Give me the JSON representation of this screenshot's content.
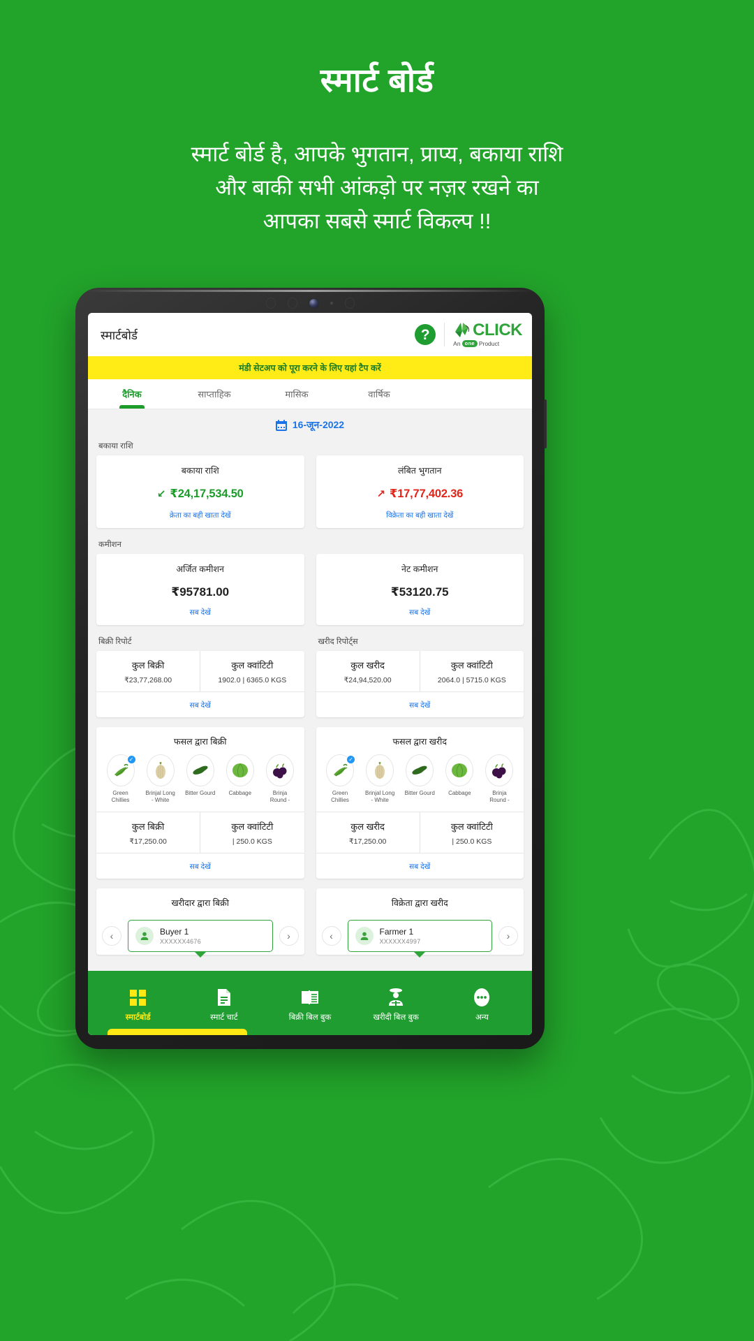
{
  "promo": {
    "title": "स्मार्ट बोर्ड",
    "sub_line1": "स्मार्ट बोर्ड है, आपके भुगतान, प्राप्य, बकाया राशि",
    "sub_line2": "और बाकी सभी आंकड़ो पर नज़र रखने का",
    "sub_line3": "आपका सबसे स्मार्ट विकल्प !!"
  },
  "colors": {
    "brand_green": "#22a32a",
    "app_green": "#1f9d30",
    "banner_yellow": "#ffeb16",
    "link_blue": "#1a73e8",
    "red": "#e1251b"
  },
  "app": {
    "title": "स्मार्टबोर्ड",
    "help_icon": "question-mark",
    "brand": {
      "word": "CLICK",
      "tagline_pre": "An",
      "tagline_pill": "one",
      "tagline_post": "Product"
    },
    "banner": "मंडी सेटअप को पूरा करने के लिए यहां टैप करें",
    "tabs": [
      {
        "label": "दैनिक",
        "active": true
      },
      {
        "label": "साप्ताहिक",
        "active": false
      },
      {
        "label": "मासिक",
        "active": false
      },
      {
        "label": "वार्षिक",
        "active": false
      }
    ],
    "date": "16-जून-2022",
    "date_icon": "calendar-icon",
    "sections": {
      "outstanding_label": "बकाया राशि",
      "commission_label": "कमीशन",
      "sales_report_label": "बिक्री रिपोर्ट",
      "purchase_report_label": "खरीद रिपोर्ट्स"
    },
    "cards": {
      "outstanding": {
        "title": "बकाया राशि",
        "amount": "₹24,17,534.50",
        "arrow": "↙",
        "link": "क्रेता का बही खाता देखें"
      },
      "pending": {
        "title": "लंबित भुगतान",
        "amount": "₹17,77,402.36",
        "arrow": "↗",
        "link": "विक्रेता का बही खाता देखें"
      },
      "earned_commission": {
        "title": "अर्जित कमीशन",
        "amount": "₹95781.00",
        "link": "सब देखें"
      },
      "net_commission": {
        "title": "नेट कमीशन",
        "amount": "₹53120.75",
        "link": "सब देखें"
      },
      "sales_report": {
        "left_title": "कुल बिक्री",
        "left_value": "₹23,77,268.00",
        "right_title": "कुल क्वांटिटी",
        "right_value": "1902.0 | 6365.0 KGS",
        "link": "सब देखें"
      },
      "purchase_report": {
        "left_title": "कुल खरीद",
        "left_value": "₹24,94,520.00",
        "right_title": "कुल क्वांटिटी",
        "right_value": "2064.0 | 5715.0 KGS",
        "link": "सब देखें"
      },
      "sales_by_crop": {
        "title": "फसल द्वारा बिक्री",
        "left_title": "कुल बिक्री",
        "left_value": "₹17,250.00",
        "right_title": "कुल क्वांटिटी",
        "right_value": "| 250.0 KGS",
        "link": "सब देखें"
      },
      "purchase_by_crop": {
        "title": "फसल द्वारा खरीद",
        "left_title": "कुल खरीद",
        "left_value": "₹17,250.00",
        "right_title": "कुल क्वांटिटी",
        "right_value": "| 250.0 KGS",
        "link": "सब देखें"
      },
      "sales_by_buyer": {
        "title": "खरीदार द्वारा बिक्री",
        "person_name": "Buyer 1",
        "person_number": "XXXXXX4676"
      },
      "purchase_by_seller": {
        "title": "विक्रेता द्वारा खरीद",
        "person_name": "Farmer 1",
        "person_number": "XXXXXX4997"
      }
    },
    "crops": [
      {
        "name_line1": "Green",
        "name_line2": "Chillies",
        "icon": "green-chilli-icon",
        "selected": true
      },
      {
        "name_line1": "Brinjal Long",
        "name_line2": "- White",
        "icon": "brinjal-white-icon",
        "selected": false
      },
      {
        "name_line1": "Bitter Gourd",
        "name_line2": "",
        "icon": "bitter-gourd-icon",
        "selected": false
      },
      {
        "name_line1": "Cabbage",
        "name_line2": "",
        "icon": "cabbage-icon",
        "selected": false
      },
      {
        "name_line1": "Brinja",
        "name_line2": "Round -",
        "icon": "brinjal-round-icon",
        "selected": false
      }
    ],
    "bottom_nav": [
      {
        "label": "स्मार्टबोर्ड",
        "icon": "dashboard-grid-icon",
        "active": true
      },
      {
        "label": "स्मार्ट चार्ट",
        "icon": "document-chart-icon",
        "active": false
      },
      {
        "label": "बिक्री बिल बुक",
        "icon": "open-book-icon",
        "active": false
      },
      {
        "label": "खरीदी बिल बुक",
        "icon": "farmer-icon",
        "active": false
      },
      {
        "label": "अन्य",
        "icon": "more-dots-icon",
        "active": false
      }
    ]
  }
}
